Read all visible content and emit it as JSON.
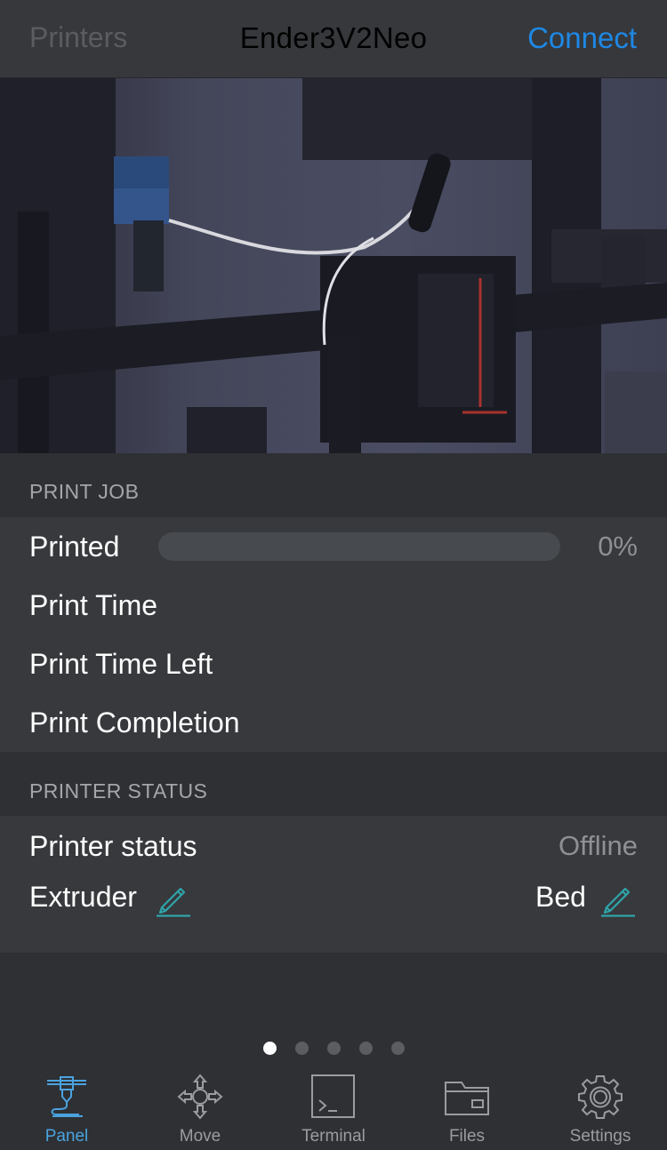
{
  "nav": {
    "back_label": "Printers",
    "title": "Ender3V2Neo",
    "action_label": "Connect"
  },
  "print_job": {
    "header": "PRINT JOB",
    "printed_label": "Printed",
    "printed_progress": 0,
    "printed_value": "0%",
    "print_time_label": "Print Time",
    "print_time_left_label": "Print Time Left",
    "print_completion_label": "Print Completion"
  },
  "printer_status": {
    "header": "PRINTER STATUS",
    "status_label": "Printer status",
    "status_value": "Offline",
    "extruder_label": "Extruder",
    "bed_label": "Bed"
  },
  "pager": {
    "count": 5,
    "active_index": 0
  },
  "tabs": [
    {
      "label": "Panel",
      "icon": "printer-icon",
      "active": true
    },
    {
      "label": "Move",
      "icon": "move-arrows-icon",
      "active": false
    },
    {
      "label": "Terminal",
      "icon": "terminal-icon",
      "active": false
    },
    {
      "label": "Files",
      "icon": "folder-icon",
      "active": false
    },
    {
      "label": "Settings",
      "icon": "gear-icon",
      "active": false
    }
  ],
  "colors": {
    "accent": "#1e88e5",
    "tab_active": "#4aa3df",
    "edit_icon": "#2fa3a8",
    "background": "#2e3034",
    "cell_background": "#37393d"
  }
}
